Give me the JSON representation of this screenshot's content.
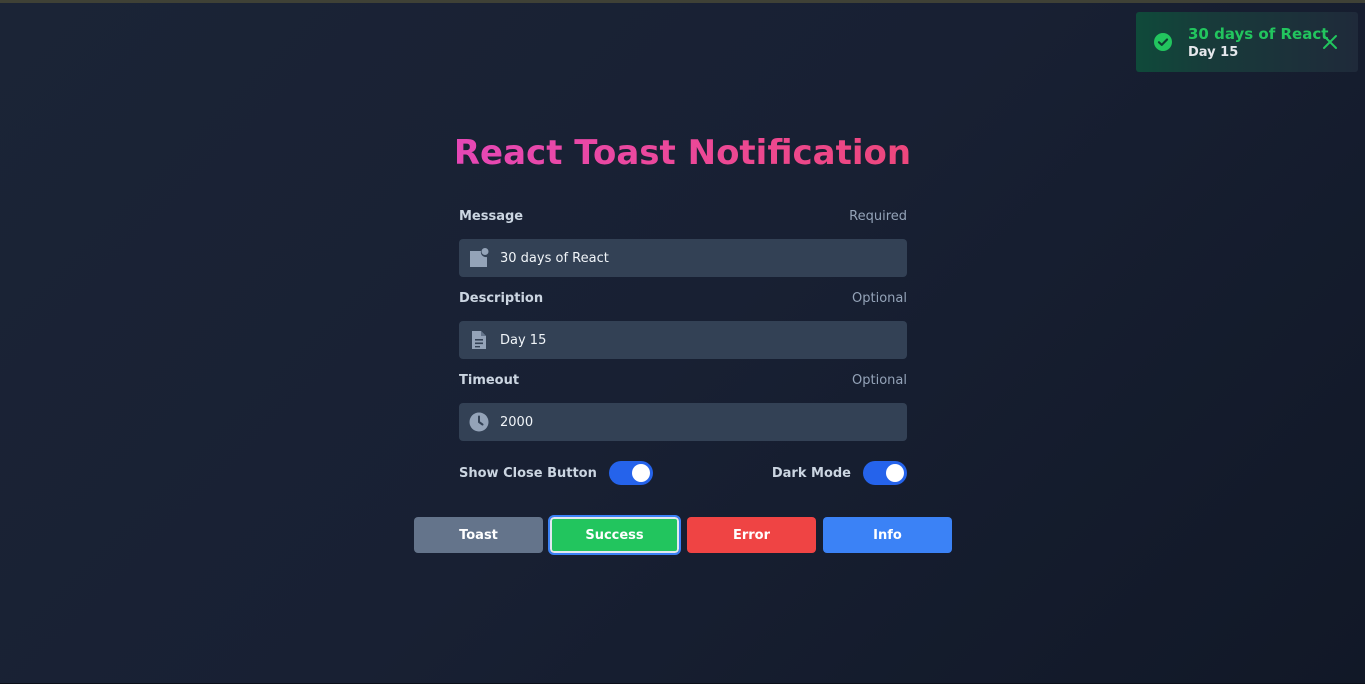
{
  "toast": {
    "title": "30 days of React",
    "description": "Day 15",
    "type": "success",
    "accent_color": "#22c55e",
    "icon": "check-circle-icon",
    "close_icon": "close-icon"
  },
  "page": {
    "title": "React Toast Notification"
  },
  "form": {
    "message": {
      "label": "Message",
      "hint": "Required",
      "value": "30 days of React",
      "icon": "message-icon"
    },
    "description": {
      "label": "Description",
      "hint": "Optional",
      "value": "Day 15",
      "icon": "document-icon"
    },
    "timeout": {
      "label": "Timeout",
      "hint": "Optional",
      "value": "2000",
      "icon": "clock-icon"
    }
  },
  "toggles": {
    "show_close_button": {
      "label": "Show Close Button",
      "on": true
    },
    "dark_mode": {
      "label": "Dark Mode",
      "on": true
    }
  },
  "buttons": {
    "toast": "Toast",
    "success": "Success",
    "error": "Error",
    "info": "Info"
  },
  "colors": {
    "toast_button": "#64748b",
    "success_button": "#22c55e",
    "error_button": "#ef4444",
    "info_button": "#3b82f6",
    "switch_on": "#2563eb",
    "input_bg": "#334155"
  }
}
